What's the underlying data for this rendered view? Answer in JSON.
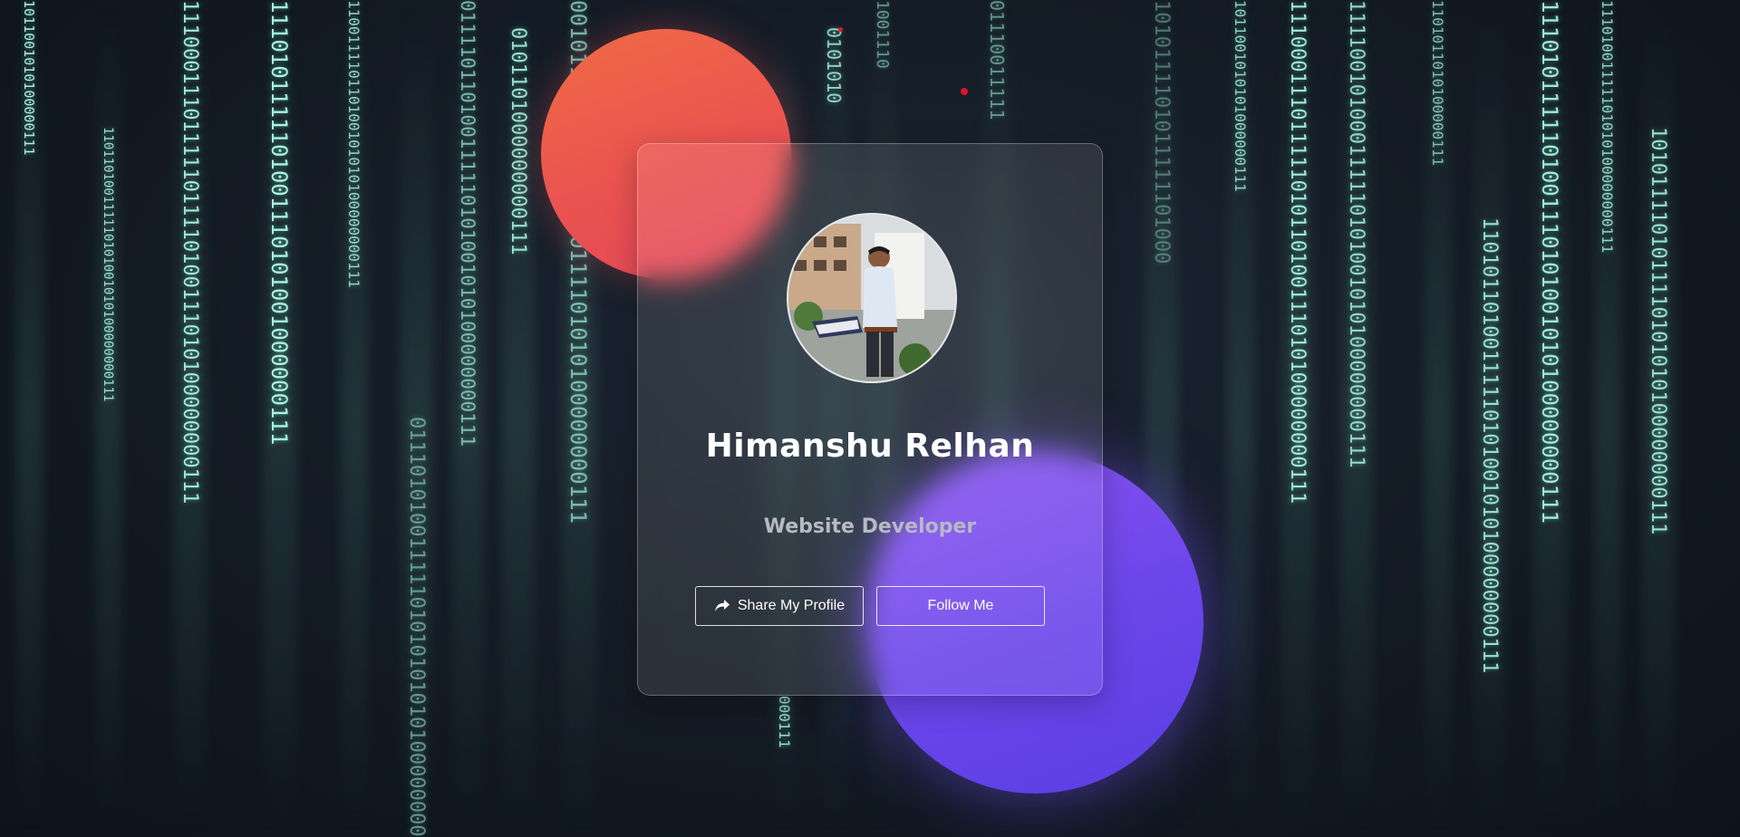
{
  "profile": {
    "name": "Himanshu Relhan",
    "title": "Website Developer",
    "avatar_alt": "profile-photo"
  },
  "actions": {
    "share_label": "Share My Profile",
    "follow_label": "Follow Me",
    "share_icon": "share-arrow-icon"
  },
  "background": {
    "columns": [
      "1011001010100000111",
      "110110100111110101001010100000000111",
      "111000111011111011110100111010100000000111",
      "1110101111101001110101001000000111",
      "110011110110100101010100000000111",
      "01110101001111101010101010100000000111",
      "011110110100111110101001010100000000111",
      "0101101000000000111",
      "0010111001010110100111101010100000000111",
      "0101010",
      "1001110",
      "01110011111",
      "000111",
      "1010111101011111101000",
      "1011001010101000000111",
      "111000111011111010110100111010100000000111",
      "111100101000111110101001010100000000111",
      "1101011010100000111",
      "11010110100111110101001010100000000111",
      "1110101111101001110101001010100000000111",
      "11101001111101010100000000111",
      "1010111101011110101010100000000111"
    ],
    "colors": {
      "code": "#a9f3e0",
      "bg_dark": "#0d131b",
      "blob_orange": "#ea5350",
      "blob_purple": "#6a45ea"
    }
  }
}
